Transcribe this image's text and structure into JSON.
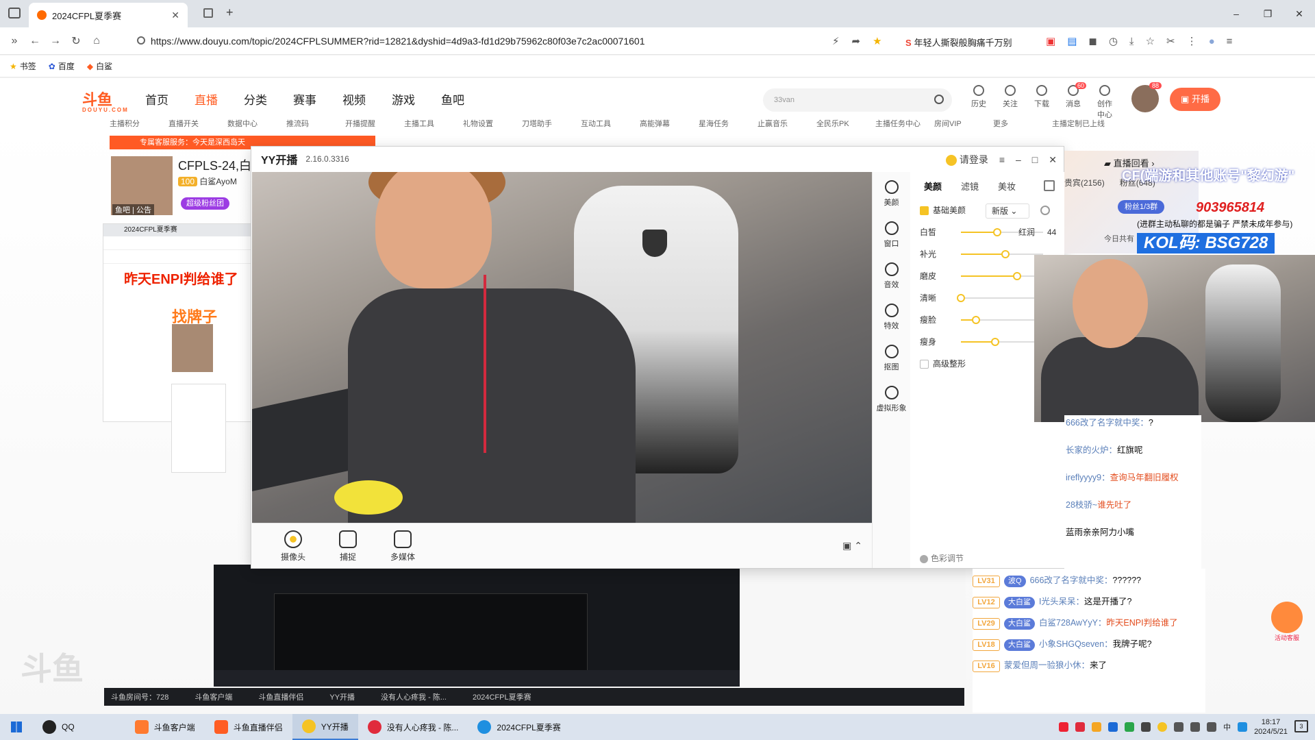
{
  "browser": {
    "tab_title": "2024CFPL夏季赛",
    "url": "https://www.douyu.com/topic/2024CFPLSUMMER?rid=12821&dyshid=4d9a3-fd1d29b75962c80f03e7c2ac00071601",
    "hot_search": "年轻人撕裂般胸痛千万别",
    "bookmarks": [
      "书签",
      "百度",
      "白鲨"
    ]
  },
  "site": {
    "logo": "斗鱼",
    "logo_sub": "DOUYU.COM",
    "nav": [
      "首页",
      "直播",
      "分类",
      "赛事",
      "视频",
      "游戏",
      "鱼吧"
    ],
    "search_placeholder": "33van",
    "header_icons": [
      "历史",
      "关注",
      "下载",
      "消息",
      "创作中心"
    ],
    "msg_badge": "60",
    "avatar_badge": "88",
    "start_live": "开播",
    "subnav": [
      "主播积分",
      "直播开关",
      "数据中心",
      "推流码",
      "开播提醒",
      "主播工具",
      "礼物设置",
      "刀塔助手",
      "互动工具",
      "高能弹幕",
      "星海任务",
      "止赢音乐",
      "全民乐PK",
      "主播任务中心",
      "房间VIP",
      "更多",
      "主播定制已上线"
    ],
    "announcement": "专属客服服务：今天是深西岛天"
  },
  "streamer": {
    "name": "CFPLS-24,白",
    "level": "100",
    "id_short": "白鲨AyoM",
    "tags": "鱼吧 | 公告",
    "fan_btn": "超级粉丝团"
  },
  "echo": {
    "headline": "昨天ENPI判给谁了",
    "sub": "找牌子",
    "room_no": "斗鱼房间号：728"
  },
  "yy": {
    "app_name": "YY开播",
    "version": "2.16.0.3316",
    "login": "请登录",
    "toolbar": [
      "摄像头",
      "捕捉",
      "多媒体"
    ],
    "side": [
      "美颜",
      "窗口",
      "音效",
      "特效",
      "抠图",
      "虚拟形象"
    ],
    "panel_tabs": [
      "美颜",
      "滤镜",
      "美妆"
    ],
    "basic_beauty": "基础美颜",
    "version_select": "新版",
    "sliders": [
      {
        "label": "白皙",
        "value": 0.44,
        "extra": "红润",
        "num": "44"
      },
      {
        "label": "补光",
        "value": 0.54,
        "extra": "",
        "num": ""
      },
      {
        "label": "磨皮",
        "value": 0.68,
        "extra": "",
        "num": ""
      },
      {
        "label": "清晰",
        "value": 0.0,
        "extra": "",
        "num": ""
      },
      {
        "label": "瘦脸",
        "value": 0.18,
        "extra": "",
        "num": ""
      },
      {
        "label": "瘦身",
        "value": 0.42,
        "extra": "",
        "num": ""
      }
    ],
    "advanced": "高级整形",
    "color_adjust": "色彩调节"
  },
  "right": {
    "replay": "直播回看",
    "tabs": [
      "贵宾(2156)",
      "粉丝(648)"
    ],
    "banner_text": "CF(端游和其他账号\"黎幻游\"",
    "qq_pill": "粉丝1/3群",
    "qq_number": "903965814",
    "scam_note": "(进群主动私聊的都是骗子 严禁未成年参与)",
    "today": "今日共有",
    "kol": "KOL码: BSG728"
  },
  "chat_upper": [
    {
      "user": "666改了名字就中奖：",
      "msg": "?",
      "red": false
    },
    {
      "user": "长家的火炉：",
      "msg": "红旗呢",
      "red": false
    },
    {
      "user": "ireflyyyy9：",
      "msg": "查询马年翻旧履权",
      "red": true
    },
    {
      "user": "28枝骄~",
      "msg": "谁先吐了",
      "red": true
    },
    {
      "user": "",
      "msg": "蓝雨亲亲阿力小嘴",
      "red": false
    }
  ],
  "chat_lower": [
    {
      "lv": "LV31",
      "fan": "波Q",
      "user": "666改了名字就中奖：",
      "msg": "??????",
      "red": false
    },
    {
      "lv": "LV12",
      "fan": "大白鲨",
      "user": "I光头呆呆：",
      "msg": "这是开播了?",
      "red": false
    },
    {
      "lv": "LV29",
      "fan": "大白鲨",
      "user": "白鲨728AwYyY：",
      "msg": "昨天ENPI判给谁了",
      "red": true
    },
    {
      "lv": "LV18",
      "fan": "大白鲨",
      "user": "小象SHGQseven：",
      "msg": "我牌子呢?",
      "red": false
    },
    {
      "lv": "LV16",
      "fan": "",
      "user": "蒙爱但周一验狼小休：",
      "msg": "来了",
      "red": false
    }
  ],
  "service": "活动客服",
  "taskbar": {
    "items": [
      "QQ",
      "斗鱼客户端",
      "斗鱼直播伴侣",
      "YY开播",
      "没有人心疼我 - 陈...",
      "2024CFPL夏季赛"
    ],
    "time": "18:17",
    "date": "2024/5/21",
    "ime": "中",
    "notif": "3"
  }
}
